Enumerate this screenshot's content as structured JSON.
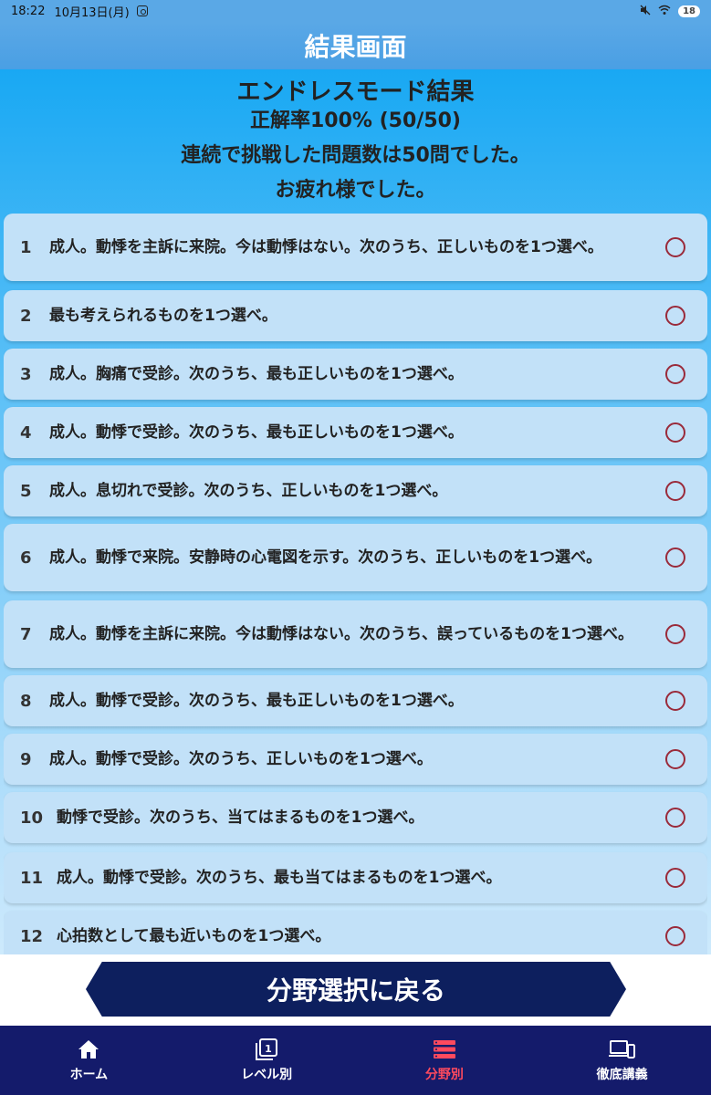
{
  "status_bar": {
    "time": "18:22",
    "date": "10月13日(月)",
    "battery": "18"
  },
  "header": {
    "title": "結果画面"
  },
  "summary": {
    "heading": "エンドレスモード結果",
    "accuracy": "正解率100% (50/50)",
    "count": "連続で挑戦した問題数は50問でした。",
    "message": "お疲れ様でした。"
  },
  "results": [
    {
      "num": "1",
      "text": "成人。動悸を主訴に来院。今は動悸はない。次のうち、正しいものを1つ選べ。",
      "mark": "circle"
    },
    {
      "num": "2",
      "text": "最も考えられるものを1つ選べ。",
      "mark": "circle"
    },
    {
      "num": "3",
      "text": "成人。胸痛で受診。次のうち、最も正しいものを1つ選べ。",
      "mark": "circle"
    },
    {
      "num": "4",
      "text": "成人。動悸で受診。次のうち、最も正しいものを1つ選べ。",
      "mark": "circle"
    },
    {
      "num": "5",
      "text": "成人。息切れで受診。次のうち、正しいものを1つ選べ。",
      "mark": "circle"
    },
    {
      "num": "6",
      "text": "成人。動悸で来院。安静時の心電図を示す。次のうち、正しいものを1つ選べ。",
      "mark": "circle"
    },
    {
      "num": "7",
      "text": "成人。動悸を主訴に来院。今は動悸はない。次のうち、誤っているものを1つ選べ。",
      "mark": "circle"
    },
    {
      "num": "8",
      "text": "成人。動悸で受診。次のうち、最も正しいものを1つ選べ。",
      "mark": "circle"
    },
    {
      "num": "9",
      "text": "成人。動悸で受診。次のうち、正しいものを1つ選べ。",
      "mark": "circle"
    },
    {
      "num": "10",
      "text": "動悸で受診。次のうち、当てはまるものを1つ選べ。",
      "mark": "circle"
    },
    {
      "num": "11",
      "text": "成人。動悸で受診。次のうち、最も当てはまるものを1つ選べ。",
      "mark": "circle"
    },
    {
      "num": "12",
      "text": "心拍数として最も近いものを1つ選べ。",
      "mark": "circle"
    }
  ],
  "back_button": {
    "label": "分野選択に戻る"
  },
  "tabs": [
    {
      "label": "ホーム",
      "icon": "home-icon"
    },
    {
      "label": "レベル別",
      "icon": "level-icon"
    },
    {
      "label": "分野別",
      "icon": "category-icon",
      "active": true
    },
    {
      "label": "徹底講義",
      "icon": "lecture-icon"
    }
  ],
  "colors": {
    "title_bar": "#4a9fe4",
    "item_bg": "#c2e1f8",
    "circle_mark": "#9a2a3a",
    "back_button": "#0d1f5e",
    "tab_bar": "#141b6b",
    "tab_active": "#ff4a5e"
  }
}
